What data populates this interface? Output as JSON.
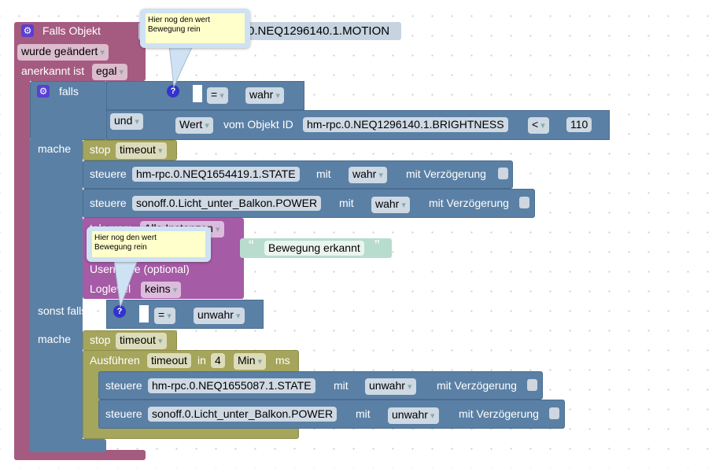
{
  "event": {
    "title": "Falls Objekt",
    "object_id": "hm-rpc.0.NEQ1296140.1.MOTION",
    "object_id_visible": "0.NEQ1296140.1.MOTION",
    "trigger": "wurde geändert",
    "ack_label": "anerkannt ist",
    "ack_value": "egal"
  },
  "if": {
    "label": "falls",
    "cond1": {
      "op": "=",
      "value": "wahr"
    },
    "and_label": "und",
    "cond2": {
      "wert": "Wert",
      "of": "vom Objekt ID",
      "object_id": "hm-rpc.0.NEQ1296140.1.BRIGHTNESS",
      "op": "<",
      "value": "110"
    },
    "do_label": "mache",
    "elseif_label": "sonst falls",
    "cond3": {
      "op": "=",
      "value": "unwahr"
    },
    "do2_label": "mache"
  },
  "stop1": {
    "label": "stop",
    "name": "timeout"
  },
  "set1": {
    "label": "steuere",
    "object": "hm-rpc.0.NEQ1654419.1.STATE",
    "with": "mit",
    "value": "wahr",
    "delay": "mit Verzögerung"
  },
  "set2": {
    "label": "steuere",
    "object": "sonoff.0.Licht_unter_Balkon.POWER",
    "with": "mit",
    "value": "wahr",
    "delay": "mit Verzögerung"
  },
  "telegram": {
    "label": "telegram",
    "instance": "Alle Instanzen",
    "username": "Username (optional)",
    "loglevel_label": "Loglevel",
    "loglevel": "keins",
    "message": "Bewegung erkannt"
  },
  "stop2": {
    "label": "stop",
    "name": "timeout"
  },
  "timeout": {
    "label": "Ausführen",
    "name": "timeout",
    "in": "in",
    "value": "4",
    "unit": "Min",
    "ms": "ms"
  },
  "set3": {
    "label": "steuere",
    "object": "hm-rpc.0.NEQ1655087.1.STATE",
    "with": "mit",
    "value": "unwahr",
    "delay": "mit Verzögerung"
  },
  "set4": {
    "label": "steuere",
    "object": "sonoff.0.Licht_unter_Balkon.POWER",
    "with": "mit",
    "value": "unwahr",
    "delay": "mit Verzögerung"
  },
  "comments": [
    "Hier nog den wert\nBewegung rein",
    "Hier nog den wert\nBewegung rein"
  ]
}
